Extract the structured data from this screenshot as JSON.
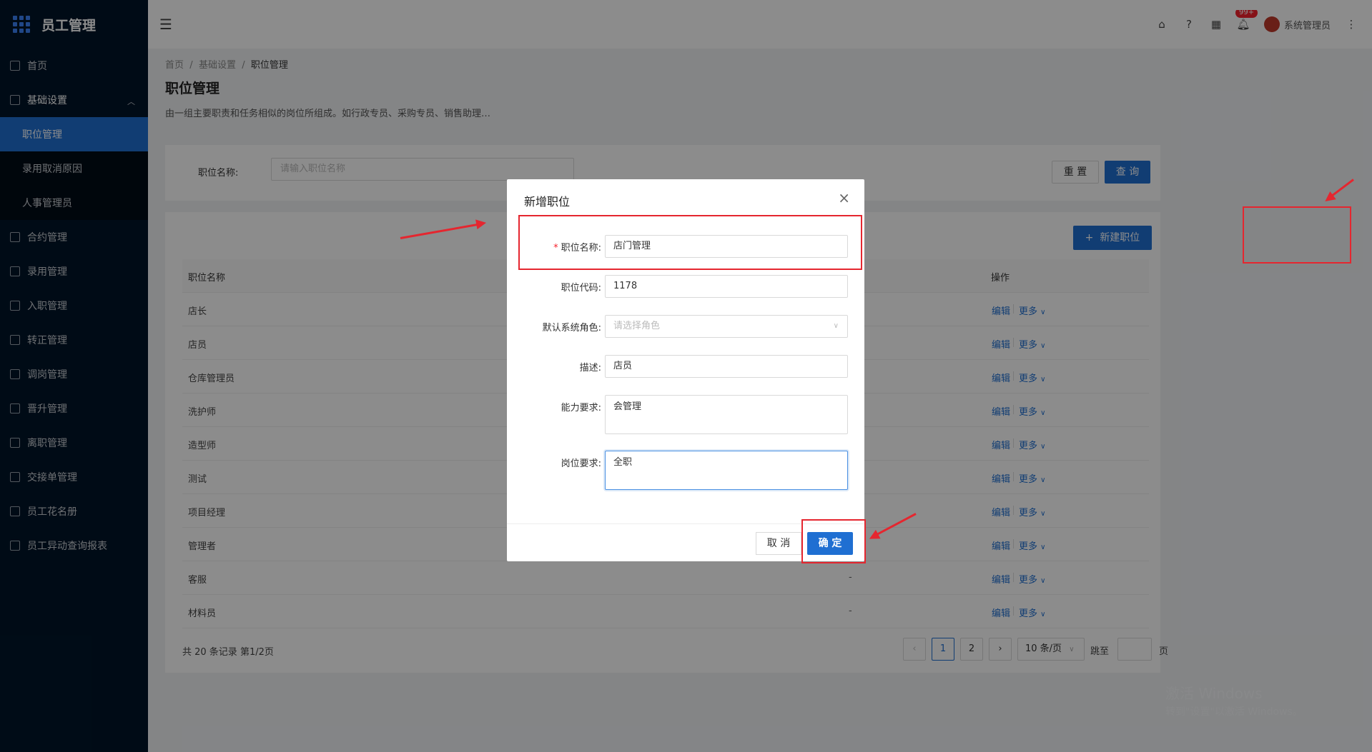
{
  "app": {
    "title": "员工管理"
  },
  "sidebar": {
    "items": [
      {
        "label": "首页",
        "icon": "home-icon"
      },
      {
        "label": "基础设置",
        "icon": "mail-icon",
        "open": true,
        "children": [
          {
            "label": "职位管理",
            "active": true
          },
          {
            "label": "录用取消原因"
          },
          {
            "label": "人事管理员"
          }
        ]
      },
      {
        "label": "合约管理",
        "icon": "calendar-icon"
      },
      {
        "label": "录用管理",
        "icon": "form-icon"
      },
      {
        "label": "入职管理",
        "icon": "file-icon"
      },
      {
        "label": "转正管理",
        "icon": "grid-icon"
      },
      {
        "label": "调岗管理",
        "icon": "user-icon"
      },
      {
        "label": "晋升管理",
        "icon": "report-icon"
      },
      {
        "label": "离职管理",
        "icon": "user-leave-icon"
      },
      {
        "label": "交接单管理",
        "icon": "copy-icon"
      },
      {
        "label": "员工花名册",
        "icon": "book-icon"
      },
      {
        "label": "员工异动查询报表",
        "icon": "table-icon"
      }
    ]
  },
  "header": {
    "notification_badge": "99+",
    "user_name": "系统管理员"
  },
  "breadcrumb": {
    "home": "首页",
    "level1": "基础设置",
    "current": "职位管理",
    "sep": "/"
  },
  "page": {
    "title": "职位管理",
    "description": "由一组主要职责和任务相似的岗位所组成。如行政专员、采购专员、销售助理…"
  },
  "filter": {
    "label": "职位名称:",
    "placeholder": "请输入职位名称",
    "reset": "重 置",
    "query": "查 询"
  },
  "table": {
    "new_button": "新建职位",
    "columns": {
      "name": "职位名称",
      "op": "操作"
    },
    "edit_label": "编辑",
    "more_label": "更多",
    "rows": [
      {
        "name": "店长",
        "dash": ""
      },
      {
        "name": "店员",
        "dash": ""
      },
      {
        "name": "仓库管理员",
        "dash": ""
      },
      {
        "name": "洗护师",
        "dash": ""
      },
      {
        "name": "造型师",
        "dash": ""
      },
      {
        "name": "测试",
        "dash": ""
      },
      {
        "name": "项目经理",
        "dash": ""
      },
      {
        "name": "管理者",
        "dash": ""
      },
      {
        "name": "客服",
        "dash": "-"
      },
      {
        "name": "材料员",
        "dash": "-"
      }
    ]
  },
  "pagination": {
    "total": "共 20 条记录 第1/2页",
    "pages": [
      "1",
      "2"
    ],
    "current": "1",
    "prev": "‹",
    "next": "›",
    "page_size": "10 条/页",
    "jump_label": "跳至",
    "page_suffix": "页"
  },
  "modal": {
    "title": "新增职位",
    "fields": {
      "name_label": "职位名称:",
      "name_value": "店门管理",
      "code_label": "职位代码:",
      "code_value": "1178",
      "role_label": "默认系统角色:",
      "role_placeholder": "请选择角色",
      "desc_label": "描述:",
      "desc_value": "店员",
      "ability_label": "能力要求:",
      "ability_value": "会管理",
      "post_label": "岗位要求:",
      "post_value": "全职"
    },
    "cancel": "取 消",
    "ok": "确 定"
  },
  "watermark": {
    "line1": "激活 Windows",
    "line2": "转到\"设置\"以激活 Windows。"
  },
  "colors": {
    "primary": "#1f6fd2",
    "sidebar": "#001529",
    "annotation": "#e5262f"
  }
}
